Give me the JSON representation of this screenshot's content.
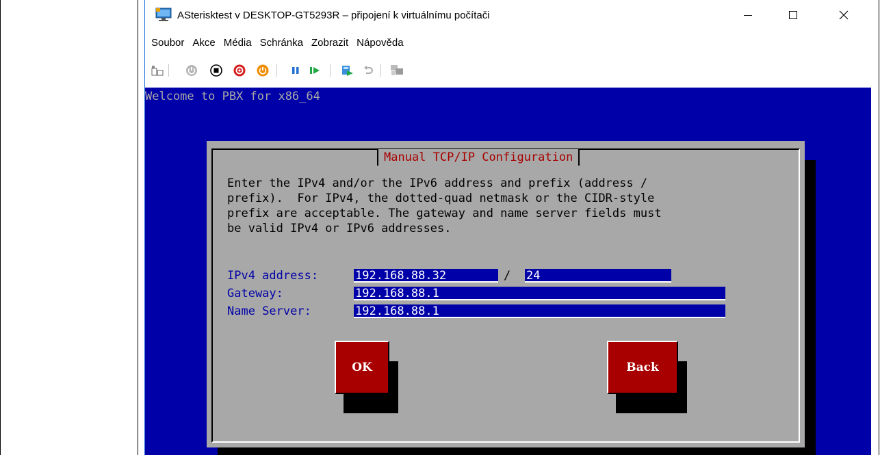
{
  "window": {
    "title": "ASterisktest v DESKTOP-GT5293R – připojení k virtuálnímu počítači",
    "minimize_glyph": "—",
    "maximize_glyph": "☐",
    "close_glyph": "✕"
  },
  "menu": {
    "items": [
      "Soubor",
      "Akce",
      "Média",
      "Schránka",
      "Zobrazit",
      "Nápověda"
    ]
  },
  "toolbar": {
    "icons": [
      "ctrl-alt-del-icon",
      "start-icon",
      "turn-off-icon",
      "shutdown-icon",
      "save-icon",
      "pause-icon",
      "resume-icon",
      "checkpoint-icon",
      "revert-icon",
      "enhanced-session-icon"
    ]
  },
  "console": {
    "welcome": "Welcome to PBX for x86_64"
  },
  "dialog": {
    "title": "Manual TCP/IP Configuration",
    "body": "Enter the IPv4 and/or the IPv6 address and prefix (address /\nprefix).  For IPv4, the dotted-quad netmask or the CIDR-style\nprefix are acceptable. The gateway and name server fields must\nbe valid IPv4 or IPv6 addresses.",
    "ipv4_label": "IPv4 address:",
    "ipv4_value": "192.168.88.32",
    "prefix_separator": "/",
    "prefix_value": "24",
    "gateway_label": "Gateway:",
    "gateway_value": "192.168.88.1",
    "nameserver_label": "Name Server:",
    "nameserver_value": "192.168.88.1",
    "ok_label": "OK",
    "back_label": "Back"
  },
  "colors": {
    "console_bg": "#0000a8",
    "dialog_bg": "#a8a8a8",
    "button_bg": "#a80000",
    "title_red": "#a80000"
  }
}
